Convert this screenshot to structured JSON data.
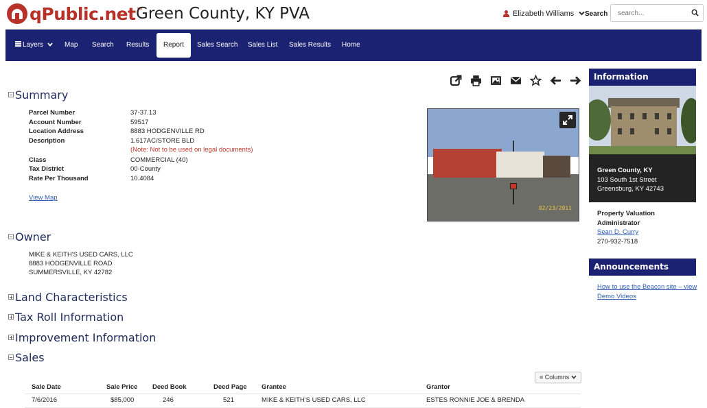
{
  "header": {
    "logo_text": "qPublic.net",
    "logo_tm": "™",
    "site_title": "Green County, KY PVA",
    "user_name": "Elizabeth Williams",
    "search_label": "Search",
    "search_placeholder": "search..."
  },
  "nav": {
    "items": [
      {
        "label": "Layers"
      },
      {
        "label": "Map"
      },
      {
        "label": "Search"
      },
      {
        "label": "Results"
      },
      {
        "label": "Report",
        "active": true
      },
      {
        "label": "Sales Search"
      },
      {
        "label": "Sales List"
      },
      {
        "label": "Sales Results"
      },
      {
        "label": "Home"
      }
    ]
  },
  "toolbar_icons": [
    "share-icon",
    "print-icon",
    "image-icon",
    "email-icon",
    "star-icon",
    "arrow-left-icon",
    "arrow-right-icon"
  ],
  "summary": {
    "title": "Summary",
    "rows": [
      {
        "key": "Parcel Number",
        "value": "37-37.13"
      },
      {
        "key": "Account Number",
        "value": "59517"
      },
      {
        "key": "Location Address",
        "value": "8883 HODGENVILLE RD"
      },
      {
        "key": "Description",
        "value": "1.617AC/STORE BLD"
      },
      {
        "key": "",
        "value": "(Note: Not to be used on legal documents)"
      },
      {
        "key": "Class",
        "value": "COMMERCIAL (40)"
      },
      {
        "key": "Tax District",
        "value": "00-County"
      },
      {
        "key": "Rate Per Thousand",
        "value": "10.4084"
      }
    ],
    "view_map": "View Map",
    "photo_date": "02/23/2011"
  },
  "owner": {
    "title": "Owner",
    "lines": [
      "MIKE & KEITH'S USED CARS, LLC",
      "8883 HODGENVILLE ROAD",
      "SUMMERSVILLE, KY 42782"
    ]
  },
  "collapsed_sections": [
    "Land Characteristics",
    "Tax Roll Information",
    "Improvement Information"
  ],
  "sales": {
    "title": "Sales",
    "columns_button": "Columns",
    "headers": [
      "Sale Date",
      "Sale Price",
      "Deed Book",
      "Deed Page",
      "Grantee",
      "Grantor"
    ],
    "rows": [
      [
        "7/6/2016",
        "$85,000",
        "246",
        "521",
        "MIKE & KEITH'S USED CARS, LLC",
        "ESTES RONNIE JOE & BRENDA"
      ]
    ]
  },
  "sidebar": {
    "info_title": "Information",
    "office_lines": [
      "Green County, KY",
      "103 South 1st Street",
      "Greensburg, KY 42743"
    ],
    "pva_title_1": "Property Valuation",
    "pva_title_2": "Administrator",
    "pva_name": "Sean D. Curry",
    "pva_phone": "270-932-7518",
    "ann_title": "Announcements",
    "ann_link_1": "How to use the Beacon site – view",
    "ann_link_2": "Demo Videos"
  },
  "colors": {
    "brand_red": "#b8322a",
    "nav_blue": "#1c2272",
    "link_blue": "#2a5db0",
    "note_red": "#c0392b"
  }
}
